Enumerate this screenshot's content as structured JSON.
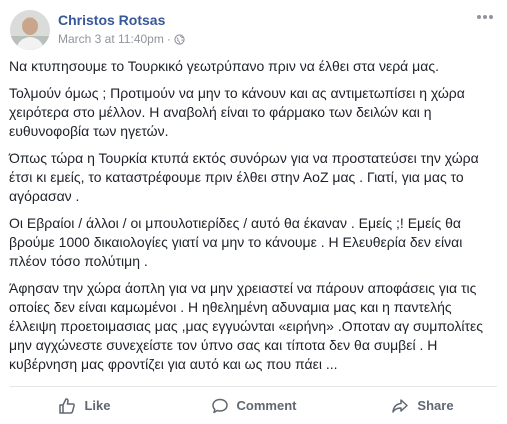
{
  "post": {
    "author": "Christos Rotsas",
    "timestamp": "March 3 at 11:40pm",
    "separator": "·",
    "privacy_icon": "globe-icon",
    "more_icon": "more-options-icon",
    "paragraphs": [
      "Να κτυπησουμε το Τουρκικό γεωτρύπανο πριν να έλθει στα νερά μας.",
      "Τολμούν όμως ; Προτιμούν να μην το κάνουν και ας αντιμετωπίσει η χώρα χειρότερα στο μέλλον. Η αναβολή είναι το φάρμακο των δειλών και η ευθυνοφοβία των ηγετών.",
      "Όπως τώρα η Τουρκία κτυπά εκτός συνόρων για να προστατεύσει την χώρα έτσι κι εμείς, το καταστρέφουμε πριν έλθει στην ΑοΖ μας . Γιατί, για μας το αγόρασαν .",
      "Οι Εβραίοι / άλλοι / οι μπουλοτιερίδες / αυτό θα έκαναν . Εμείς ;! Εμείς θα βρούμε 1000 δικαιολογίες γιατί να μην το κάνουμε . Η Ελευθερία δεν είναι πλέον τόσο πολύτιμη .",
      "Άφησαν την χώρα άοπλη για να μην χρειαστεί να πάρουν αποφάσεις για τις οποίες δεν είναι καμωμένοι . Η ηθελημένη αδυναμια μας και η παντελής έλλειψη προετοιμασιας μας ,μας εγγυώνται «ειρήνη» .Οποταν αγ συμπολίτες μην αγχώνεστε συνεχείστε τον ύπνο σας και τίποτα δεν θα συμβεί . Η κυβέρνηση μας φροντίζει για αυτό και ως που πάει ..."
    ]
  },
  "actions": {
    "like_label": "Like",
    "like_icon": "thumbs-up-icon",
    "comment_label": "Comment",
    "comment_icon": "comment-icon",
    "share_label": "Share",
    "share_icon": "share-icon"
  },
  "colors": {
    "author": "#365899",
    "meta": "#90949c",
    "text": "#1d2129",
    "action": "#606770",
    "divider": "#e5e5e5"
  }
}
